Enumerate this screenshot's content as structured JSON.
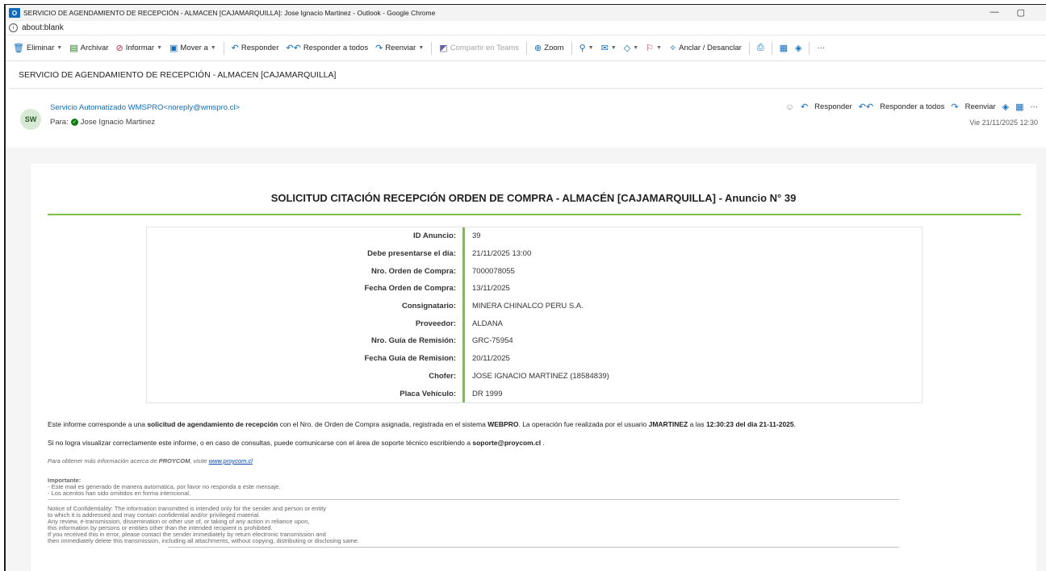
{
  "window": {
    "title": "SERVICIO DE AGENDAMIENTO DE RECEPCIÓN - ALMACEN [CAJAMARQUILLA]: Jose Ignacio Martinez - Outlook - Google Chrome",
    "app_icon_letter": "O",
    "minimize": "—",
    "restore": "▢"
  },
  "address": {
    "url": "about:blank"
  },
  "toolbar": {
    "delete": "Eliminar",
    "archive": "Archivar",
    "report": "Informar",
    "move": "Mover a",
    "reply": "Responder",
    "reply_all": "Responder a todos",
    "forward": "Reenviar",
    "share_teams": "Compartir en Teams",
    "zoom": "Zoom",
    "pin": "Anclar / Desanclar",
    "more": "···"
  },
  "subject": "SERVICIO DE AGENDAMIENTO DE RECEPCIÓN - ALMACEN [CAJAMARQUILLA]",
  "message": {
    "avatar_initials": "SW",
    "sender": "Servicio Automatizado WMSPRO<noreply@wmspro.cl>",
    "to_label": "Para:",
    "to_name": "Jose Ignacio Martinez",
    "reply": "Responder",
    "reply_all": "Responder a todos",
    "forward": "Reenviar",
    "more": "···",
    "date": "Vie 21/11/2025 12:30"
  },
  "email": {
    "title": "SOLICITUD CITACIÓN RECEPCIÓN ORDEN DE COMPRA - ALMACÉN [CAJAMARQUILLA] - Anuncio N° 39",
    "details": [
      {
        "label": "ID Anuncio:",
        "value": "39"
      },
      {
        "label": "Debe presentarse el día:",
        "value": "21/11/2025 13:00"
      },
      {
        "label": "Nro. Orden de Compra:",
        "value": "7000078055"
      },
      {
        "label": "Fecha Orden de Compra:",
        "value": "13/11/2025"
      },
      {
        "label": "Consignatario:",
        "value": "MINERA CHINALCO PERU S.A."
      },
      {
        "label": "Proveedor:",
        "value": "ALDANA"
      },
      {
        "label": "Nro. Guía de Remisión:",
        "value": "GRC-75954"
      },
      {
        "label": "Fecha Guía de Remision:",
        "value": "20/11/2025"
      },
      {
        "label": "Chofer:",
        "value": "JOSE IGNACIO MARTINEZ (18584839)"
      },
      {
        "label": "Placa Vehículo:",
        "value": "DR 1999"
      }
    ],
    "p1": {
      "t1": "Este informe corresponde a una ",
      "b1": "solicitud de agendamiento de recepción",
      "t2": " con el Nro. de Orden de Compra asignada, registrada en el sistema ",
      "b2": "WEBPRO",
      "t3": ". La operación fue realizada por el usuario ",
      "b3": "JMARTINEZ",
      "t4": " a las ",
      "b4": "12:30:23 del dia 21-11-2025",
      "t5": "."
    },
    "p2": {
      "t1": "Si no logra visualizar correctamente este informe, o en caso de consultas, puede comunicarse con el área de soporte técnico escribiendo a ",
      "b1": "soporte@proycom.cl",
      "t2": " ."
    },
    "p3": {
      "t1": "Para obtener más información acerca de ",
      "b1": "PROYCOM",
      "t2": ", visite ",
      "link": "www.proycom.cl"
    },
    "important_title": "Importante:",
    "important_lines": [
      "- Este mail es generado de manera automatica, por favor no responda a este mensaje.",
      "- Los acentos han sido omitidos en forma intencional."
    ],
    "notice_lines": [
      "Notice of Confidentiality: The information transmitted is intended only for the sender and person or entity",
      "to which it is addressed and may contain confidential and/or privileged material.",
      "Any review, e-transmission, dissemination or other use of, or taking of any action in reliance upon,",
      "this information by persons or entities other than the intended recipient is prohibited.",
      "If you received this in error, please contact the sender immediately by return electronic transmission and",
      "then immediately delete this transmission, including all attachments, without copying, distributing or disclosing same."
    ]
  }
}
